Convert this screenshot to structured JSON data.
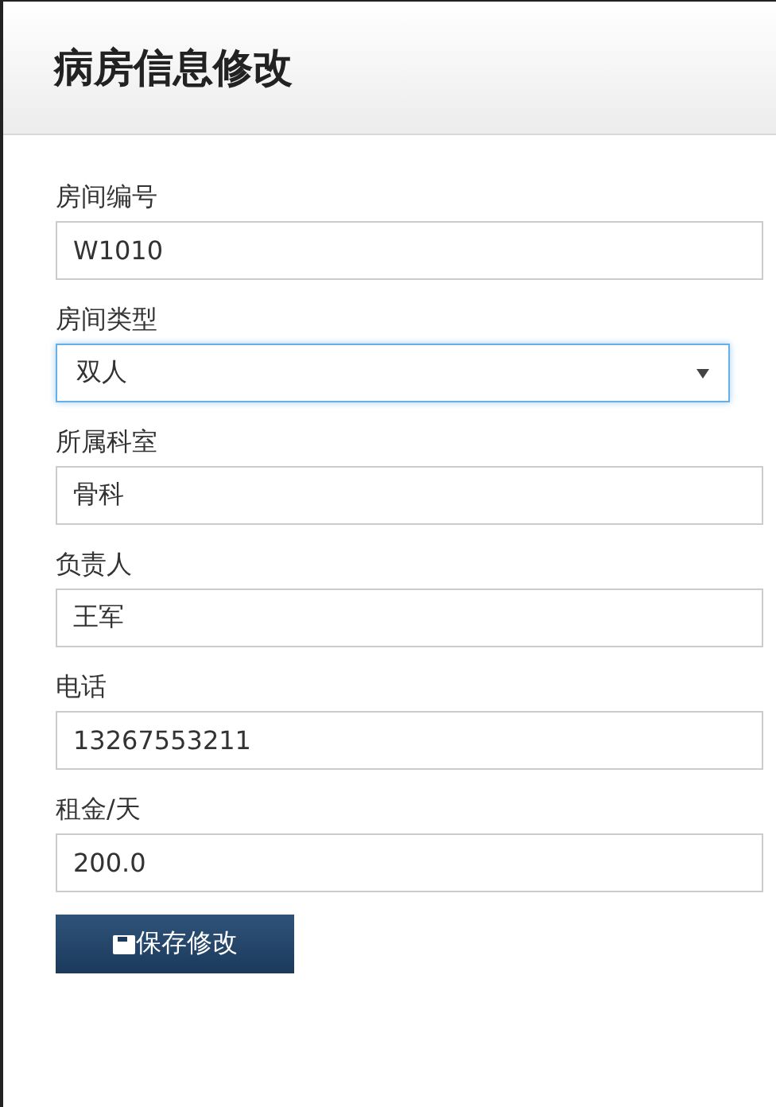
{
  "header": {
    "title": "病房信息修改"
  },
  "fields": [
    {
      "kind": "text",
      "label": "房间编号",
      "value": "W1010"
    },
    {
      "kind": "select",
      "label": "房间类型",
      "value": "双人",
      "focused": true
    },
    {
      "kind": "text",
      "label": "所属科室",
      "value": "骨科"
    },
    {
      "kind": "text",
      "label": "负责人",
      "value": "王军"
    },
    {
      "kind": "text",
      "label": "电话",
      "value": "13267553211"
    },
    {
      "kind": "text",
      "label": "租金/天",
      "value": "200.0"
    }
  ],
  "save_button": {
    "label": "保存修改"
  }
}
